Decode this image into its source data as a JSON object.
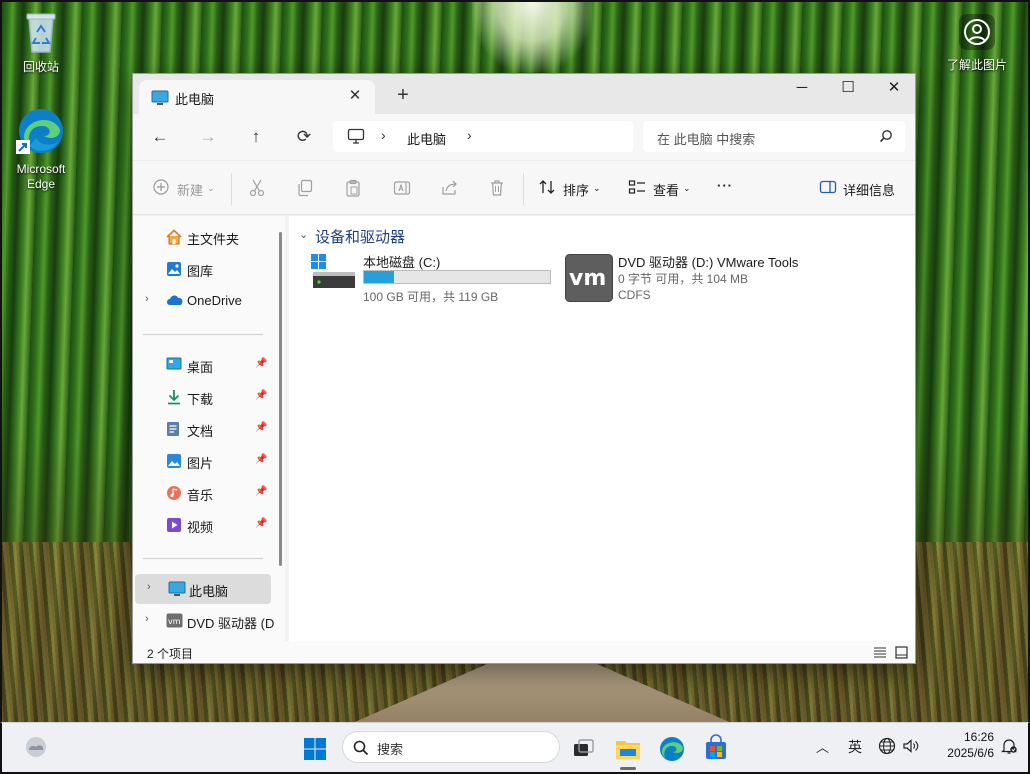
{
  "desktop": {
    "icons": [
      {
        "label": "回收站"
      },
      {
        "label": "Microsoft Edge"
      },
      {
        "label": "了解此图片"
      }
    ]
  },
  "window": {
    "tab_title": "此电脑",
    "tab_close": "✕",
    "new_tab": "+",
    "controls": {
      "minimize": "─",
      "maximize": "☐",
      "close": "✕"
    },
    "nav": {
      "back": "←",
      "forward": "→",
      "up": "↑",
      "refresh": "⟳"
    },
    "address": {
      "sep1": "›",
      "text": "此电脑",
      "sep2": "›"
    },
    "search_placeholder": "在 此电脑 中搜索",
    "toolbar": {
      "new_label": "新建",
      "sort_label": "排序",
      "view_label": "查看",
      "more": "···",
      "details_label": "详细信息"
    },
    "sidebar": {
      "items": [
        {
          "label": "主文件夹"
        },
        {
          "label": "图库"
        },
        {
          "label": "OneDrive"
        },
        {
          "label": "桌面"
        },
        {
          "label": "下载"
        },
        {
          "label": "文档"
        },
        {
          "label": "图片"
        },
        {
          "label": "音乐"
        },
        {
          "label": "视频"
        },
        {
          "label": "此电脑"
        },
        {
          "label": "DVD 驱动器 (D"
        }
      ]
    },
    "content": {
      "group_title": "设备和驱动器",
      "drives": [
        {
          "name": "本地磁盘 (C:)",
          "free_text": "100 GB 可用，共 119 GB",
          "used_fraction": 0.16
        },
        {
          "name": "DVD 驱动器 (D:) VMware Tools",
          "free_text": "0 字节 可用，共 104 MB",
          "fs": "CDFS"
        }
      ]
    },
    "status": "2 个项目"
  },
  "taskbar": {
    "search_label": "搜索",
    "ime": "英",
    "time": "16:26",
    "date": "2025/6/6"
  },
  "colors": {
    "accent": "#26a0da",
    "selection": "#dcdcdc"
  }
}
